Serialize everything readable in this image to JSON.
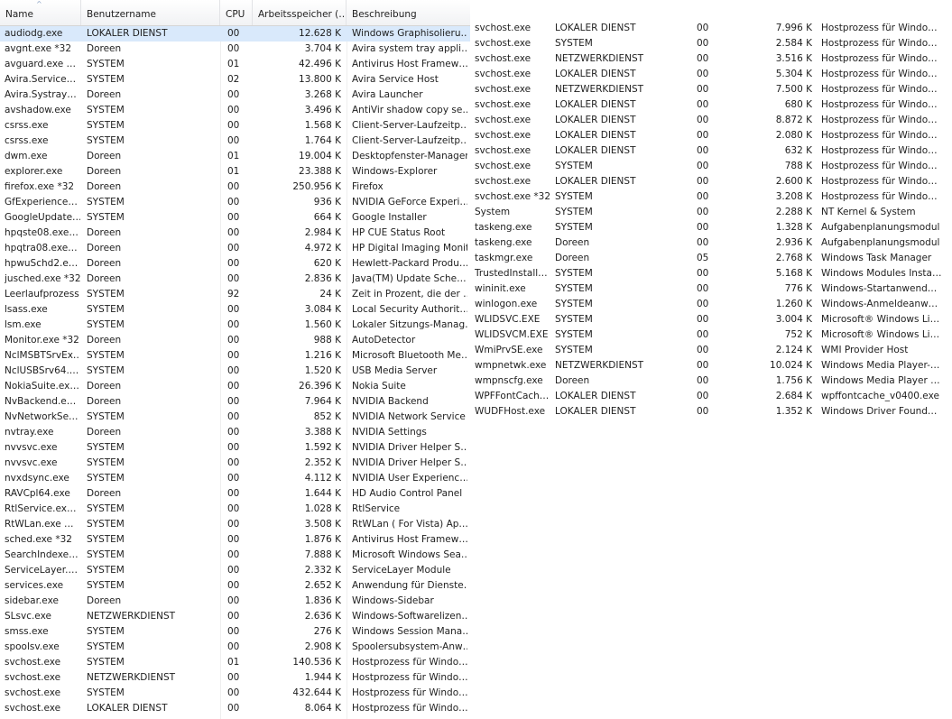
{
  "columns": {
    "name": "Name",
    "user": "Benutzername",
    "cpu": "CPU",
    "memory": "Arbeitsspeicher (…",
    "description": "Beschreibung"
  },
  "left_rows": [
    {
      "name": "audiodg.exe",
      "user": "LOKALER DIENST",
      "cpu": "00",
      "mem": "12.628 K",
      "desc": "Windows Graphisolieru…"
    },
    {
      "name": "avgnt.exe *32",
      "user": "Doreen",
      "cpu": "00",
      "mem": "3.704 K",
      "desc": "Avira system tray appli…"
    },
    {
      "name": "avguard.exe …",
      "user": "SYSTEM",
      "cpu": "01",
      "mem": "42.496 K",
      "desc": "Antivirus Host Framew…"
    },
    {
      "name": "Avira.Service…",
      "user": "SYSTEM",
      "cpu": "02",
      "mem": "13.800 K",
      "desc": "Avira Service Host"
    },
    {
      "name": "Avira.Systray…",
      "user": "Doreen",
      "cpu": "00",
      "mem": "3.268 K",
      "desc": "Avira Launcher"
    },
    {
      "name": "avshadow.exe",
      "user": "SYSTEM",
      "cpu": "00",
      "mem": "3.496 K",
      "desc": "AntiVir shadow copy se…"
    },
    {
      "name": "csrss.exe",
      "user": "SYSTEM",
      "cpu": "00",
      "mem": "1.568 K",
      "desc": "Client-Server-Laufzeitp…"
    },
    {
      "name": "csrss.exe",
      "user": "SYSTEM",
      "cpu": "00",
      "mem": "1.764 K",
      "desc": "Client-Server-Laufzeitp…"
    },
    {
      "name": "dwm.exe",
      "user": "Doreen",
      "cpu": "01",
      "mem": "19.004 K",
      "desc": "Desktopfenster-Manager"
    },
    {
      "name": "explorer.exe",
      "user": "Doreen",
      "cpu": "01",
      "mem": "23.388 K",
      "desc": "Windows-Explorer"
    },
    {
      "name": "firefox.exe *32",
      "user": "Doreen",
      "cpu": "00",
      "mem": "250.956 K",
      "desc": "Firefox"
    },
    {
      "name": "GfExperience…",
      "user": "SYSTEM",
      "cpu": "00",
      "mem": "936 K",
      "desc": "NVIDIA GeForce Experi…"
    },
    {
      "name": "GoogleUpdate…",
      "user": "SYSTEM",
      "cpu": "00",
      "mem": "664 K",
      "desc": "Google Installer"
    },
    {
      "name": "hpqste08.exe…",
      "user": "Doreen",
      "cpu": "00",
      "mem": "2.984 K",
      "desc": "HP CUE Status Root"
    },
    {
      "name": "hpqtra08.exe…",
      "user": "Doreen",
      "cpu": "00",
      "mem": "4.972 K",
      "desc": "HP Digital Imaging Monitor"
    },
    {
      "name": "hpwuSchd2.e…",
      "user": "Doreen",
      "cpu": "00",
      "mem": "620 K",
      "desc": "Hewlett-Packard Produ…"
    },
    {
      "name": "jusched.exe *32",
      "user": "Doreen",
      "cpu": "00",
      "mem": "2.836 K",
      "desc": "Java(TM) Update Sche…"
    },
    {
      "name": "Leerlaufprozess",
      "user": "SYSTEM",
      "cpu": "92",
      "mem": "24 K",
      "desc": "Zeit in Prozent, die der …"
    },
    {
      "name": "lsass.exe",
      "user": "SYSTEM",
      "cpu": "00",
      "mem": "3.084 K",
      "desc": "Local Security Authorit…"
    },
    {
      "name": "lsm.exe",
      "user": "SYSTEM",
      "cpu": "00",
      "mem": "1.560 K",
      "desc": "Lokaler Sitzungs-Manag…"
    },
    {
      "name": "Monitor.exe *32",
      "user": "Doreen",
      "cpu": "00",
      "mem": "988 K",
      "desc": "AutoDetector"
    },
    {
      "name": "NclMSBTSrvEx…",
      "user": "SYSTEM",
      "cpu": "00",
      "mem": "1.216 K",
      "desc": "Microsoft Bluetooth Me…"
    },
    {
      "name": "NclUSBSrv64.…",
      "user": "SYSTEM",
      "cpu": "00",
      "mem": "1.520 K",
      "desc": "USB Media Server"
    },
    {
      "name": "NokiaSuite.ex…",
      "user": "Doreen",
      "cpu": "00",
      "mem": "26.396 K",
      "desc": "Nokia Suite"
    },
    {
      "name": "NvBackend.e…",
      "user": "Doreen",
      "cpu": "00",
      "mem": "7.964 K",
      "desc": "NVIDIA Backend"
    },
    {
      "name": "NvNetworkSe…",
      "user": "SYSTEM",
      "cpu": "00",
      "mem": "852 K",
      "desc": "NVIDIA Network Service"
    },
    {
      "name": "nvtray.exe",
      "user": "Doreen",
      "cpu": "00",
      "mem": "3.388 K",
      "desc": "NVIDIA Settings"
    },
    {
      "name": "nvvsvc.exe",
      "user": "SYSTEM",
      "cpu": "00",
      "mem": "1.592 K",
      "desc": "NVIDIA Driver Helper S…"
    },
    {
      "name": "nvvsvc.exe",
      "user": "SYSTEM",
      "cpu": "00",
      "mem": "2.352 K",
      "desc": "NVIDIA Driver Helper S…"
    },
    {
      "name": "nvxdsync.exe",
      "user": "SYSTEM",
      "cpu": "00",
      "mem": "4.112 K",
      "desc": "NVIDIA User Experienc…"
    },
    {
      "name": "RAVCpl64.exe",
      "user": "Doreen",
      "cpu": "00",
      "mem": "1.644 K",
      "desc": "HD Audio Control Panel"
    },
    {
      "name": "RtlService.ex…",
      "user": "SYSTEM",
      "cpu": "00",
      "mem": "1.028 K",
      "desc": "RtlService"
    },
    {
      "name": "RtWLan.exe …",
      "user": "SYSTEM",
      "cpu": "00",
      "mem": "3.508 K",
      "desc": "RtWLan ( For Vista) Ap…"
    },
    {
      "name": "sched.exe *32",
      "user": "SYSTEM",
      "cpu": "00",
      "mem": "1.876 K",
      "desc": "Antivirus Host Framew…"
    },
    {
      "name": "SearchIndexe…",
      "user": "SYSTEM",
      "cpu": "00",
      "mem": "7.888 K",
      "desc": "Microsoft Windows Sea…"
    },
    {
      "name": "ServiceLayer.…",
      "user": "SYSTEM",
      "cpu": "00",
      "mem": "2.332 K",
      "desc": "ServiceLayer Module"
    },
    {
      "name": "services.exe",
      "user": "SYSTEM",
      "cpu": "00",
      "mem": "2.652 K",
      "desc": "Anwendung für Dienste…"
    },
    {
      "name": "sidebar.exe",
      "user": "Doreen",
      "cpu": "00",
      "mem": "1.836 K",
      "desc": "Windows-Sidebar"
    },
    {
      "name": "SLsvc.exe",
      "user": "NETZWERKDIENST",
      "cpu": "00",
      "mem": "2.636 K",
      "desc": "Windows-Softwarelizen…"
    },
    {
      "name": "smss.exe",
      "user": "SYSTEM",
      "cpu": "00",
      "mem": "276 K",
      "desc": "Windows Session Mana…"
    },
    {
      "name": "spoolsv.exe",
      "user": "SYSTEM",
      "cpu": "00",
      "mem": "2.908 K",
      "desc": "Spoolersubsystem-Anw…"
    },
    {
      "name": "svchost.exe",
      "user": "SYSTEM",
      "cpu": "01",
      "mem": "140.536 K",
      "desc": "Hostprozess für Windo…"
    },
    {
      "name": "svchost.exe",
      "user": "NETZWERKDIENST",
      "cpu": "00",
      "mem": "1.944 K",
      "desc": "Hostprozess für Windo…"
    },
    {
      "name": "svchost.exe",
      "user": "SYSTEM",
      "cpu": "00",
      "mem": "432.644 K",
      "desc": "Hostprozess für Windo…"
    },
    {
      "name": "svchost.exe",
      "user": "LOKALER DIENST",
      "cpu": "00",
      "mem": "8.064 K",
      "desc": "Hostprozess für Windo…"
    }
  ],
  "right_rows": [
    {
      "name": "svchost.exe",
      "user": "LOKALER DIENST",
      "cpu": "00",
      "mem": "7.996 K",
      "desc": "Hostprozess für Windo…"
    },
    {
      "name": "svchost.exe",
      "user": "SYSTEM",
      "cpu": "00",
      "mem": "2.584 K",
      "desc": "Hostprozess für Windo…"
    },
    {
      "name": "svchost.exe",
      "user": "NETZWERKDIENST",
      "cpu": "00",
      "mem": "3.516 K",
      "desc": "Hostprozess für Windo…"
    },
    {
      "name": "svchost.exe",
      "user": "LOKALER DIENST",
      "cpu": "00",
      "mem": "5.304 K",
      "desc": "Hostprozess für Windo…"
    },
    {
      "name": "svchost.exe",
      "user": "NETZWERKDIENST",
      "cpu": "00",
      "mem": "7.500 K",
      "desc": "Hostprozess für Windo…"
    },
    {
      "name": "svchost.exe",
      "user": "LOKALER DIENST",
      "cpu": "00",
      "mem": "680 K",
      "desc": "Hostprozess für Windo…"
    },
    {
      "name": "svchost.exe",
      "user": "LOKALER DIENST",
      "cpu": "00",
      "mem": "8.872 K",
      "desc": "Hostprozess für Windo…"
    },
    {
      "name": "svchost.exe",
      "user": "LOKALER DIENST",
      "cpu": "00",
      "mem": "2.080 K",
      "desc": "Hostprozess für Windo…"
    },
    {
      "name": "svchost.exe",
      "user": "LOKALER DIENST",
      "cpu": "00",
      "mem": "632 K",
      "desc": "Hostprozess für Windo…"
    },
    {
      "name": "svchost.exe",
      "user": "SYSTEM",
      "cpu": "00",
      "mem": "788 K",
      "desc": "Hostprozess für Windo…"
    },
    {
      "name": "svchost.exe",
      "user": "LOKALER DIENST",
      "cpu": "00",
      "mem": "2.600 K",
      "desc": "Hostprozess für Windo…"
    },
    {
      "name": "svchost.exe *32",
      "user": "SYSTEM",
      "cpu": "00",
      "mem": "3.208 K",
      "desc": "Hostprozess für Windo…"
    },
    {
      "name": "System",
      "user": "SYSTEM",
      "cpu": "00",
      "mem": "2.288 K",
      "desc": "NT Kernel & System"
    },
    {
      "name": "taskeng.exe",
      "user": "SYSTEM",
      "cpu": "00",
      "mem": "1.328 K",
      "desc": "Aufgabenplanungsmodul"
    },
    {
      "name": "taskeng.exe",
      "user": "Doreen",
      "cpu": "00",
      "mem": "2.936 K",
      "desc": "Aufgabenplanungsmodul"
    },
    {
      "name": "taskmgr.exe",
      "user": "Doreen",
      "cpu": "05",
      "mem": "2.768 K",
      "desc": "Windows Task Manager"
    },
    {
      "name": "TrustedInstall…",
      "user": "SYSTEM",
      "cpu": "00",
      "mem": "5.168 K",
      "desc": "Windows Modules Insta…"
    },
    {
      "name": "wininit.exe",
      "user": "SYSTEM",
      "cpu": "00",
      "mem": "776 K",
      "desc": "Windows-Startanwend…"
    },
    {
      "name": "winlogon.exe",
      "user": "SYSTEM",
      "cpu": "00",
      "mem": "1.260 K",
      "desc": "Windows-Anmeldeanw…"
    },
    {
      "name": "WLIDSVC.EXE",
      "user": "SYSTEM",
      "cpu": "00",
      "mem": "3.004 K",
      "desc": "Microsoft® Windows Li…"
    },
    {
      "name": "WLIDSVCM.EXE",
      "user": "SYSTEM",
      "cpu": "00",
      "mem": "752 K",
      "desc": "Microsoft® Windows Li…"
    },
    {
      "name": "WmiPrvSE.exe",
      "user": "SYSTEM",
      "cpu": "00",
      "mem": "2.124 K",
      "desc": "WMI Provider Host"
    },
    {
      "name": "wmpnetwk.exe",
      "user": "NETZWERKDIENST",
      "cpu": "00",
      "mem": "10.024 K",
      "desc": "Windows Media Player-…"
    },
    {
      "name": "wmpnscfg.exe",
      "user": "Doreen",
      "cpu": "00",
      "mem": "1.756 K",
      "desc": "Windows Media Player …"
    },
    {
      "name": "WPFFontCach…",
      "user": "LOKALER DIENST",
      "cpu": "00",
      "mem": "2.684 K",
      "desc": "wpffontcache_v0400.exe"
    },
    {
      "name": "WUDFHost.exe",
      "user": "LOKALER DIENST",
      "cpu": "00",
      "mem": "1.352 K",
      "desc": "Windows Driver Found…"
    }
  ],
  "colors": {
    "selected_row": "#d9e9fb",
    "sort_arrow": "#8aa2c4",
    "header_border": "#d5d5d5"
  },
  "icons": {
    "sort": "sort-ascending-icon"
  }
}
